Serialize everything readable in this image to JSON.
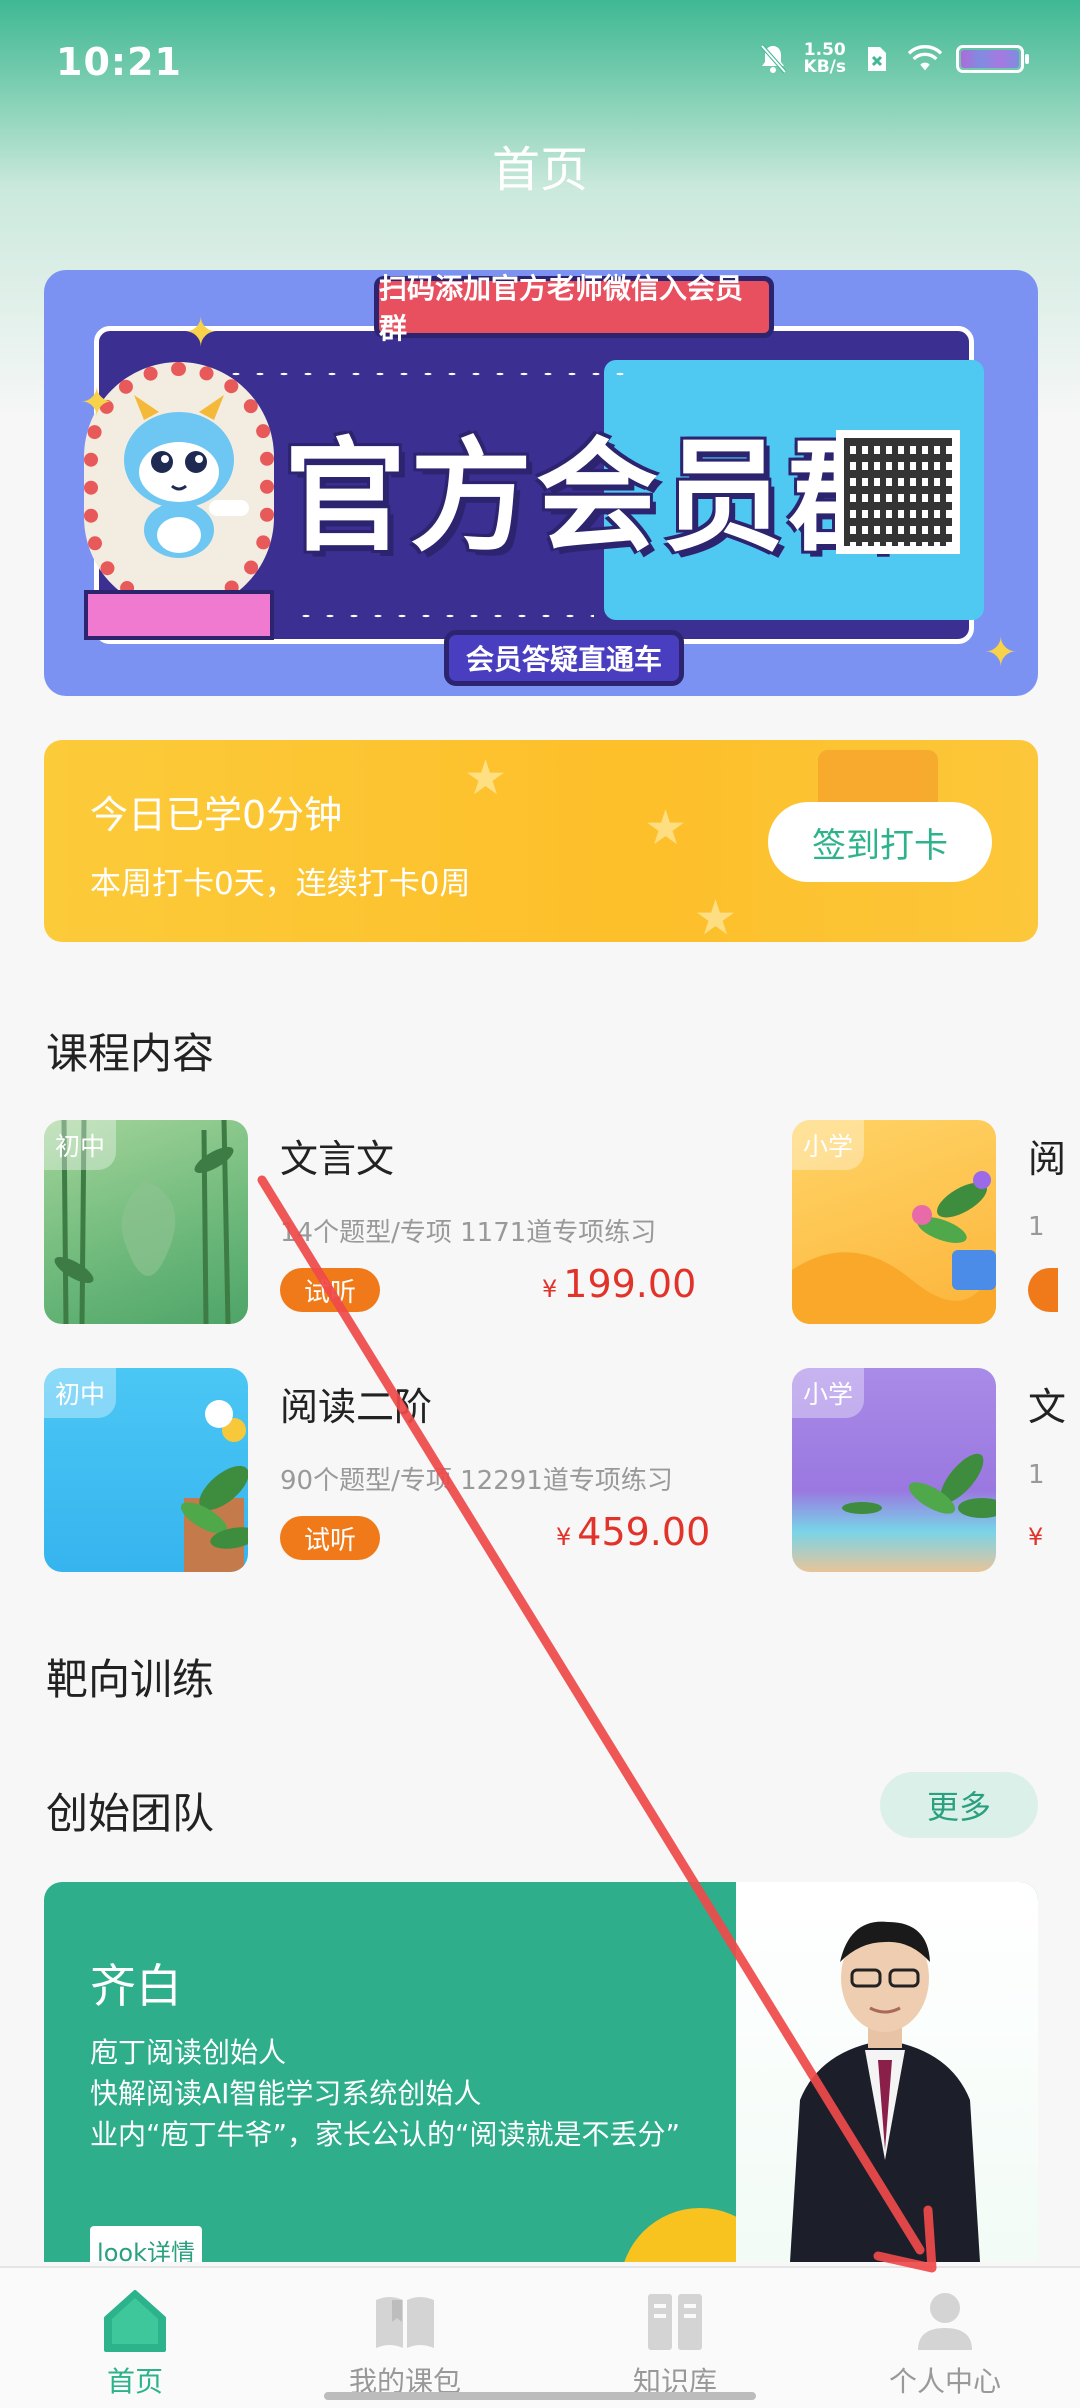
{
  "status_bar": {
    "time": "10:21",
    "net_speed_value": "1.50",
    "net_speed_unit": "KB/s"
  },
  "page": {
    "title": "首页"
  },
  "banner": {
    "top_label": "扫码添加官方老师微信入会员群",
    "headline": "官方会员群",
    "bottom_label": "会员答疑直通车"
  },
  "checkin": {
    "title": "今日已学0分钟",
    "subtitle": "本周打卡0天，连续打卡0周",
    "button_label": "签到打卡"
  },
  "sections": {
    "courses": "课程内容",
    "training": "靶向训练",
    "team": "创始团队",
    "more_label": "更多"
  },
  "courses": [
    {
      "tag": "初中",
      "name": "文言文",
      "meta": "14个题型/专项  1171道专项练习",
      "trial": "试听",
      "currency": "¥",
      "price": "199.00"
    },
    {
      "tag": "初中",
      "name": "阅读二阶",
      "meta": "90个题型/专项  12291道专项练习",
      "trial": "试听",
      "currency": "¥",
      "price": "459.00"
    },
    {
      "tag": "小学",
      "name": "阅",
      "meta": "1",
      "trial": "",
      "currency": "",
      "price": ""
    },
    {
      "tag": "小学",
      "name": "文",
      "meta": "1",
      "trial": "",
      "currency": "¥",
      "price": ""
    }
  ],
  "founder": {
    "name": "齐白",
    "desc_lines": [
      "庖丁阅读创始人",
      "快解阅读AI智能学习系统创始人",
      "业内“庖丁牛爷”，家长公认的“阅读就是不丢分”"
    ],
    "detail_button": "look详情"
  },
  "bottom_nav": [
    {
      "label": "首页",
      "icon": "home-icon",
      "active": true
    },
    {
      "label": "我的课包",
      "icon": "book-icon",
      "active": false
    },
    {
      "label": "知识库",
      "icon": "library-icon",
      "active": false
    },
    {
      "label": "个人中心",
      "icon": "person-icon",
      "active": false
    }
  ],
  "colors": {
    "accent": "#2db38c",
    "price": "#e2332a",
    "trial": "#f07a1a",
    "checkin_bg": "#fdbf2a",
    "banner_bg": "#7b92f2",
    "annotation": "#ef4a4a"
  }
}
